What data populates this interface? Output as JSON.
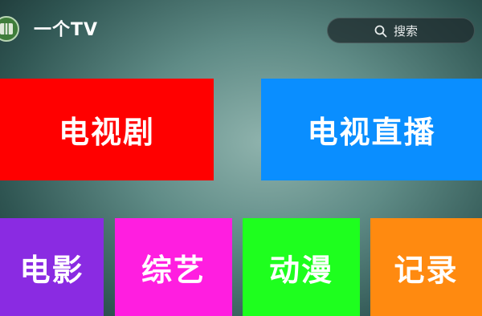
{
  "app": {
    "title": "一个TV",
    "logo_icon": "app-logo-icon"
  },
  "search": {
    "label": "搜索",
    "icon": "search-icon"
  },
  "tiles": {
    "tv_series": {
      "label": "电视剧",
      "color": "#ff0000"
    },
    "live_tv": {
      "label": "电视直播",
      "color": "#0a8eff"
    },
    "movies": {
      "label": "电影",
      "color": "#8a2be2"
    },
    "variety": {
      "label": "综艺",
      "color": "#ff1ee0"
    },
    "anime": {
      "label": "动漫",
      "color": "#1eff1e"
    },
    "documentary": {
      "label": "记录",
      "color": "#ff8a10"
    }
  }
}
